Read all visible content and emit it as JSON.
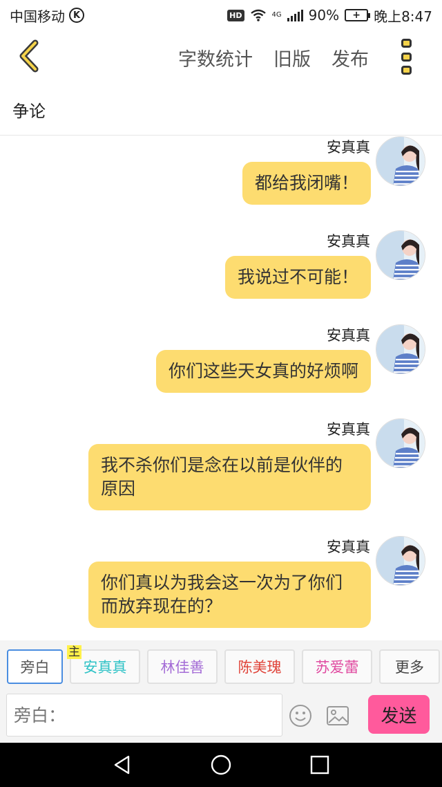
{
  "status_bar": {
    "carrier": "中国移动",
    "carrier_badge": "K",
    "hd": "HD",
    "network": "4G",
    "battery": "90%",
    "time": "晚上8:47"
  },
  "header": {
    "actions": [
      "字数统计",
      "旧版",
      "发布"
    ]
  },
  "chat": {
    "title": "争论",
    "messages": [
      {
        "name": "安真真",
        "text": "都给我闭嘴！"
      },
      {
        "name": "安真真",
        "text": "我说过不可能！"
      },
      {
        "name": "安真真",
        "text": "你们这些天女真的好烦啊"
      },
      {
        "name": "安真真",
        "text": "我不杀你们是念在以前是伙伴的原因"
      },
      {
        "name": "安真真",
        "text": "你们真以为我会这一次为了你们而放弃现在的？"
      }
    ]
  },
  "roles": {
    "narrator": "旁白",
    "host_tag": "主",
    "characters": [
      {
        "label": "安真真",
        "color": "#2ec2c6"
      },
      {
        "label": "林佳善",
        "color": "#a46cd6"
      },
      {
        "label": "陈美瑰",
        "color": "#e0443a"
      },
      {
        "label": "苏爱蕾",
        "color": "#e04aa0"
      }
    ],
    "more": "更多"
  },
  "input": {
    "placeholder": "旁白：",
    "send_label": "发送"
  },
  "colors": {
    "bubble": "#fddc70",
    "send": "#ff5a9c",
    "accent": "#f5d34a"
  }
}
